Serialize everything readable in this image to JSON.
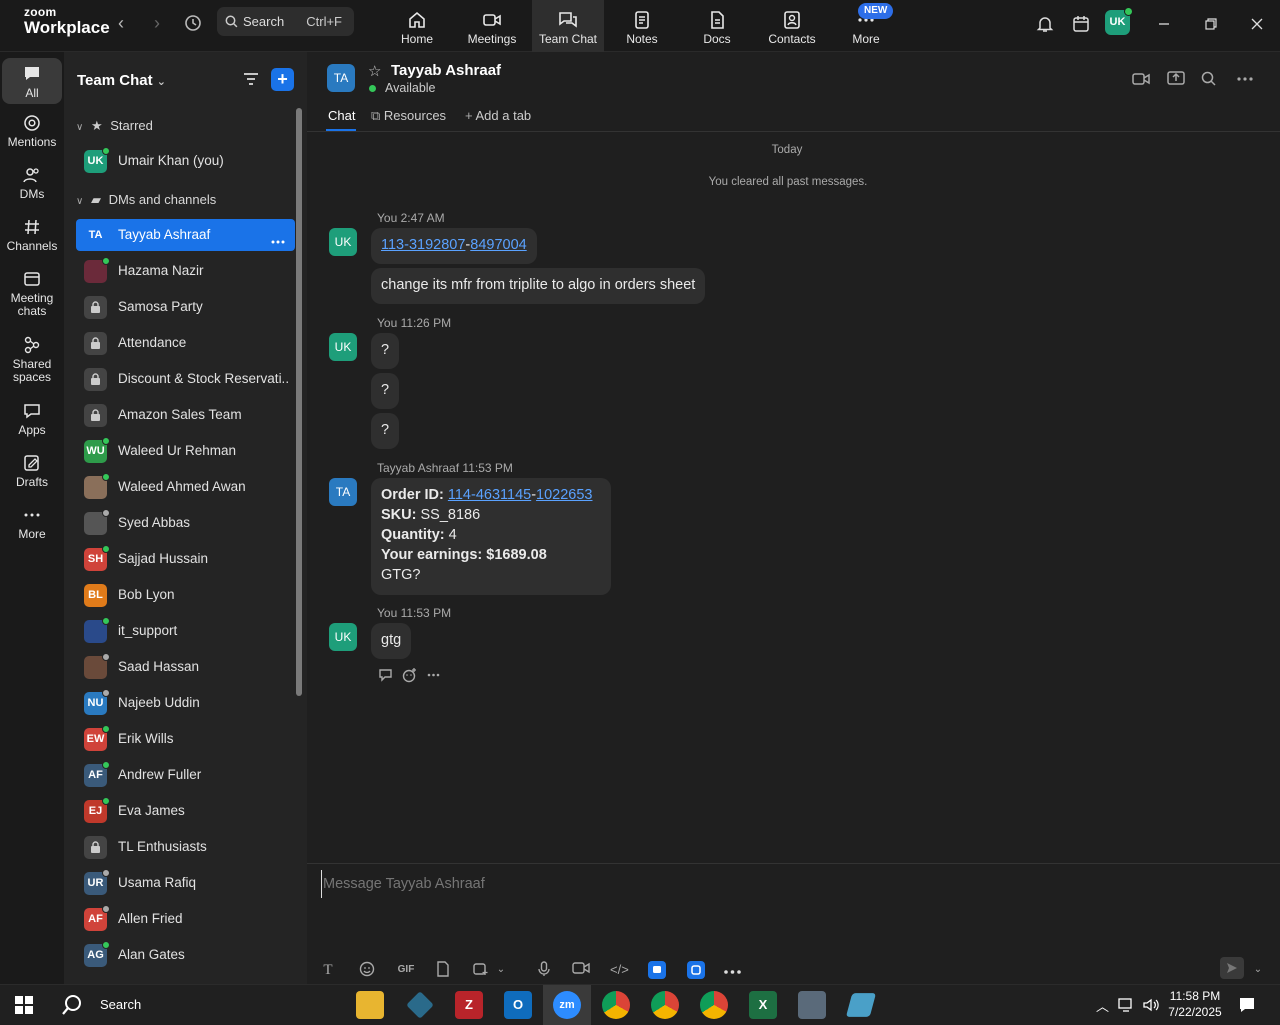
{
  "app": {
    "brand_top": "zoom",
    "brand_bottom": "Workplace"
  },
  "search": {
    "label": "Search",
    "shortcut": "Ctrl+F"
  },
  "topnav": [
    {
      "label": "Home"
    },
    {
      "label": "Meetings"
    },
    {
      "label": "Team Chat"
    },
    {
      "label": "Notes"
    },
    {
      "label": "Docs"
    },
    {
      "label": "Contacts"
    },
    {
      "label": "More"
    }
  ],
  "new_badge": "NEW",
  "user_avatar": "UK",
  "rail": [
    {
      "label": "All"
    },
    {
      "label": "Mentions"
    },
    {
      "label": "DMs"
    },
    {
      "label": "Channels"
    },
    {
      "label": "Meeting chats"
    },
    {
      "label": "Shared spaces"
    },
    {
      "label": "Apps"
    },
    {
      "label": "Drafts"
    },
    {
      "label": "More"
    }
  ],
  "sidebar": {
    "title": "Team Chat",
    "starred_label": "Starred",
    "dms_label": "DMs and channels",
    "starred": [
      {
        "initials": "UK",
        "name": "Umair Khan (you)",
        "color": "#1e9e7a",
        "status": "#34c759"
      }
    ],
    "items": [
      {
        "initials": "TA",
        "name": "Tayyab Ashraaf",
        "color": "#1a73e8",
        "status": ""
      },
      {
        "initials": "",
        "name": "Hazama Nazir",
        "color": "#6b2a3a",
        "status": "#34c759"
      },
      {
        "initials": "🔒",
        "name": "Samosa Party",
        "color": "#444",
        "status": ""
      },
      {
        "initials": "🔒",
        "name": "Attendance",
        "color": "#444",
        "status": ""
      },
      {
        "initials": "🔒",
        "name": "Discount & Stock Reservati...",
        "color": "#444",
        "status": ""
      },
      {
        "initials": "🔒",
        "name": "Amazon Sales Team",
        "color": "#444",
        "status": ""
      },
      {
        "initials": "WU",
        "name": "Waleed Ur Rehman",
        "color": "#2e9b4a",
        "status": "#34c759"
      },
      {
        "initials": "",
        "name": "Waleed Ahmed Awan",
        "color": "#8a6f5a",
        "status": "#34c759"
      },
      {
        "initials": "",
        "name": "Syed Abbas",
        "color": "#555",
        "status": "#aaaaaa"
      },
      {
        "initials": "SH",
        "name": "Sajjad Hussain",
        "color": "#d0433a",
        "status": "#34c759"
      },
      {
        "initials": "BL",
        "name": "Bob Lyon",
        "color": "#e07b1a",
        "status": ""
      },
      {
        "initials": "",
        "name": "it_support",
        "color": "#2a4a8a",
        "status": "#34c759"
      },
      {
        "initials": "",
        "name": "Saad Hassan",
        "color": "#6a4a3a",
        "status": "#aaaaaa"
      },
      {
        "initials": "NU",
        "name": "Najeeb Uddin",
        "color": "#2a7ac0",
        "status": "#aaaaaa"
      },
      {
        "initials": "EW",
        "name": "Erik Wills",
        "color": "#d0433a",
        "status": "#34c759"
      },
      {
        "initials": "AF",
        "name": "Andrew Fuller",
        "color": "#3a5a7a",
        "status": "#34c759"
      },
      {
        "initials": "EJ",
        "name": "Eva James",
        "color": "#c0392b",
        "status": "#34c759"
      },
      {
        "initials": "🔒",
        "name": "TL Enthusiasts",
        "color": "#444",
        "status": ""
      },
      {
        "initials": "UR",
        "name": "Usama Rafiq",
        "color": "#3a5a7a",
        "status": "#aaaaaa"
      },
      {
        "initials": "AF",
        "name": "Allen Fried",
        "color": "#d0433a",
        "status": "#aaaaaa"
      },
      {
        "initials": "AG",
        "name": "Alan Gates",
        "color": "#3a5a7a",
        "status": "#34c759"
      }
    ]
  },
  "chat": {
    "avatar": "TA",
    "name": "Tayyab Ashraaf",
    "status": "Available",
    "tabs": {
      "chat": "Chat",
      "resources": "Resources",
      "add": "Add a tab"
    },
    "date_divider": "Today",
    "cleared": "You cleared all past messages.",
    "groups": [
      {
        "avatar": "UK",
        "sender": "You",
        "time": "2:47 AM"
      },
      {
        "avatar": "UK",
        "sender": "You",
        "time": "11:26 PM"
      },
      {
        "avatar": "TA",
        "sender": "Tayyab Ashraaf",
        "time": "11:53 PM"
      },
      {
        "avatar": "UK",
        "sender": "You",
        "time": "11:53 PM"
      }
    ],
    "msg1": {
      "link_a": "113-3192807",
      "sep": "-",
      "link_b": "8497004"
    },
    "msg2": "change its mfr from triplite to algo in orders sheet",
    "msg_q": "?",
    "order": {
      "id_label": "Order ID:",
      "id_a": "114-4631145",
      "id_sep": "-",
      "id_b": "1022653",
      "sku_label": "SKU:",
      "sku": "SS_8186",
      "qty_label": "Quantity:",
      "qty": "4",
      "earn_label": "Your earnings: $1689.08",
      "gtg": "GTG?"
    },
    "reply": "gtg"
  },
  "composer": {
    "placeholder": "Message Tayyab Ashraaf",
    "gif": "GIF"
  },
  "taskbar": {
    "search": "Search",
    "time": "11:58 PM",
    "date": "7/22/2025"
  }
}
